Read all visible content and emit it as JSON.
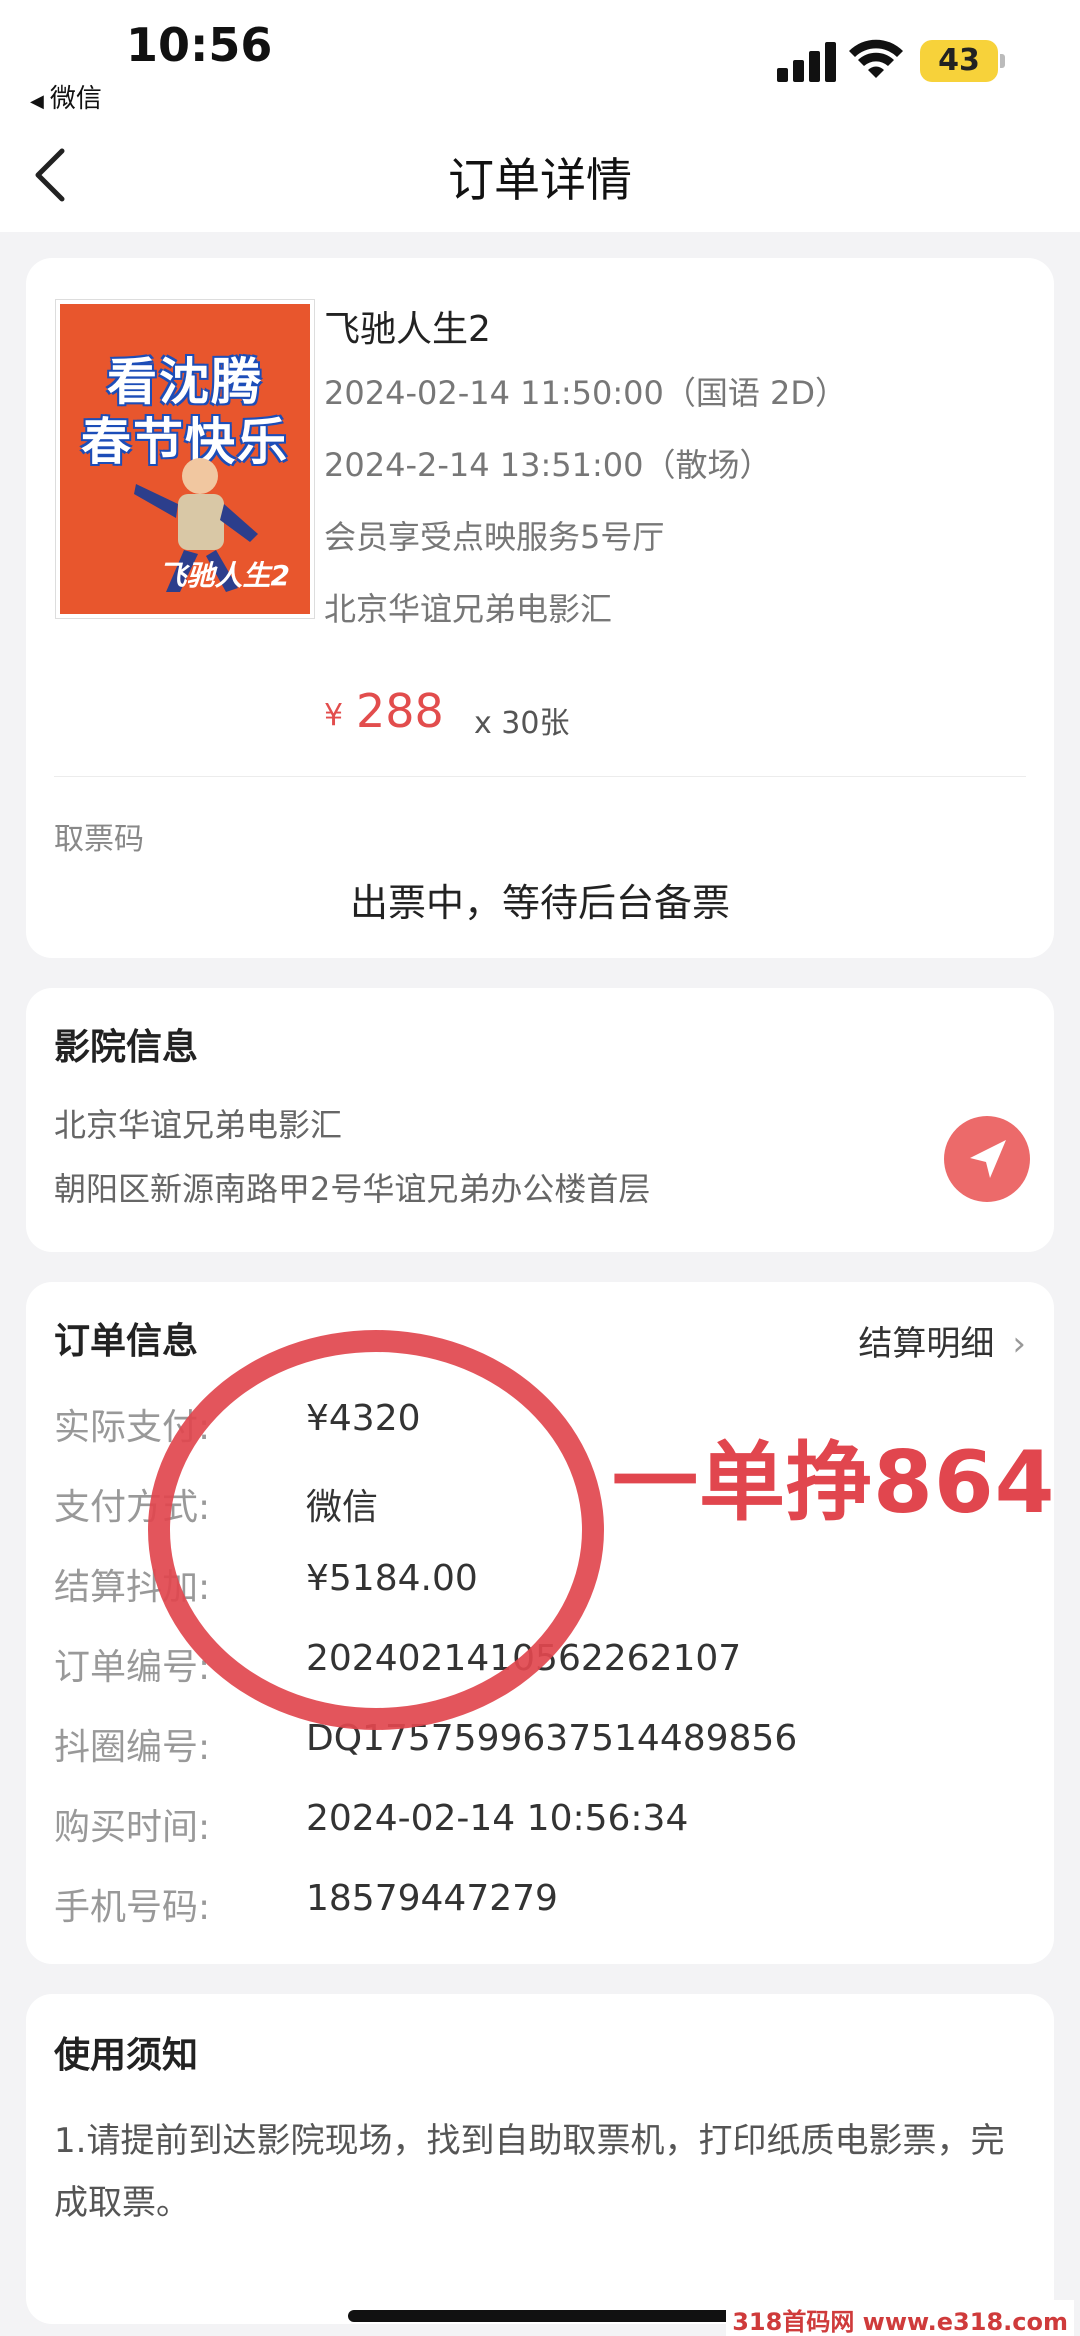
{
  "status_bar": {
    "time": "10:56",
    "back_app": "微信",
    "battery": "43"
  },
  "nav": {
    "title": "订单详情"
  },
  "movie": {
    "poster_line1": "看沈腾",
    "poster_line2": "春节快乐",
    "poster_small": "飞驰人生2",
    "title": "飞驰人生2",
    "showtime": "2024-02-14 11:50:00（国语 2D）",
    "endtime": "2024-2-14 13:51:00（散场）",
    "hall": "会员享受点映服务5号厅",
    "cinema": "北京华谊兄弟电影汇",
    "price_symbol": "¥",
    "price": "288",
    "quantity": "x 30张"
  },
  "ticket": {
    "label": "取票码",
    "status": "出票中，等待后台备票"
  },
  "cinema_info": {
    "title": "影院信息",
    "name": "北京华谊兄弟电影汇",
    "address": "朝阳区新源南路甲2号华谊兄弟办公楼首层"
  },
  "order_info": {
    "title": "订单信息",
    "detail_link": "结算明细",
    "rows": [
      {
        "label": "实际支付:",
        "value": "¥4320"
      },
      {
        "label": "支付方式:",
        "value": "微信"
      },
      {
        "label": "结算抖加:",
        "value": "¥5184.00"
      },
      {
        "label": "订单编号:",
        "value": "20240214105622621​07"
      },
      {
        "label": "抖圈编号:",
        "value": "DQ1757599637514489856"
      },
      {
        "label": "购买时间:",
        "value": "2024-02-14 10:56:34"
      },
      {
        "label": "手机号码:",
        "value": "18579447279"
      }
    ]
  },
  "notice": {
    "title": "使用须知",
    "text": "1.请提前到达影院现场，找到自助取票机，打印纸质电影票，完成取票。"
  },
  "annotation": {
    "text": "一单挣864"
  },
  "watermark": "318首码网 www.e318.com",
  "colors": {
    "accent_red": "#e24d4d",
    "annotation_red": "#e1464e",
    "battery_yellow": "#f7d23a"
  }
}
